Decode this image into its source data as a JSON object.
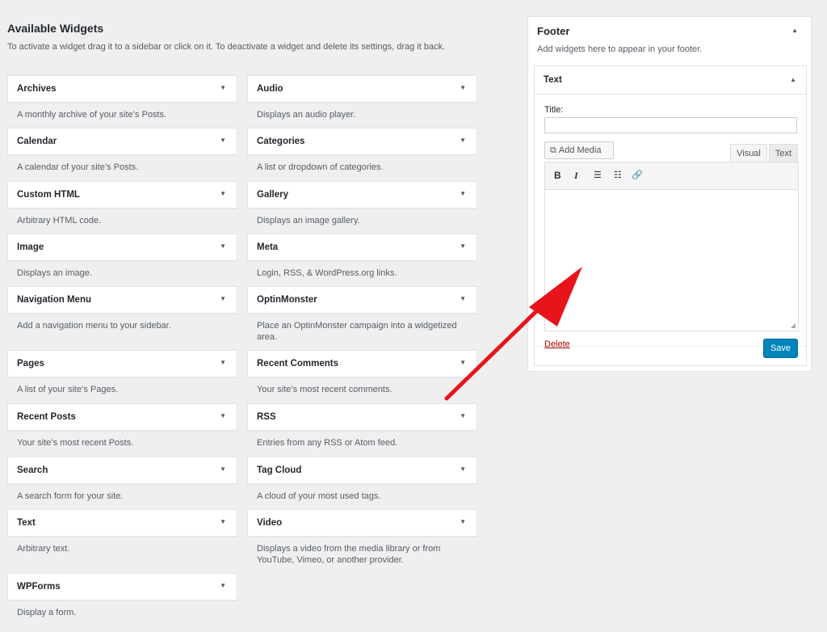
{
  "available": {
    "title": "Available Widgets",
    "intro": "To activate a widget drag it to a sidebar or click on it. To deactivate a widget and delete its settings, drag it back."
  },
  "widgets_left": [
    {
      "title": "Archives",
      "desc": "A monthly archive of your site’s Posts."
    },
    {
      "title": "Calendar",
      "desc": "A calendar of your site’s Posts."
    },
    {
      "title": "Custom HTML",
      "desc": "Arbitrary HTML code."
    },
    {
      "title": "Image",
      "desc": "Displays an image."
    },
    {
      "title": "Navigation Menu",
      "desc": "Add a navigation menu to your sidebar."
    },
    {
      "title": "Pages",
      "desc": "A list of your site’s Pages."
    },
    {
      "title": "Recent Posts",
      "desc": "Your site’s most recent Posts."
    },
    {
      "title": "Search",
      "desc": "A search form for your site."
    },
    {
      "title": "Text",
      "desc": "Arbitrary text."
    },
    {
      "title": "WPForms",
      "desc": "Display a form."
    }
  ],
  "widgets_right": [
    {
      "title": "Audio",
      "desc": "Displays an audio player."
    },
    {
      "title": "Categories",
      "desc": "A list or dropdown of categories."
    },
    {
      "title": "Gallery",
      "desc": "Displays an image gallery."
    },
    {
      "title": "Meta",
      "desc": "Login, RSS, & WordPress.org links."
    },
    {
      "title": "OptinMonster",
      "desc": "Place an OptinMonster campaign into a widgetized area."
    },
    {
      "title": "Recent Comments",
      "desc": "Your site’s most recent comments."
    },
    {
      "title": "RSS",
      "desc": "Entries from any RSS or Atom feed."
    },
    {
      "title": "Tag Cloud",
      "desc": "A cloud of your most used tags."
    },
    {
      "title": "Video",
      "desc": "Displays a video from the media library or from YouTube, Vimeo, or another provider."
    }
  ],
  "icons": {
    "expand": "▼",
    "collapse": "▲",
    "media": "⧉",
    "bold": "B",
    "italic": "I",
    "bullet_list": "☰",
    "numbered_list": "☷",
    "link": "🔗",
    "resize": "◢"
  },
  "footer": {
    "title": "Footer",
    "desc": "Add widgets here to appear in your footer.",
    "text_widget": {
      "title": "Text",
      "title_label": "Title:",
      "title_value": "",
      "add_media": "Add Media",
      "tab_visual": "Visual",
      "tab_text": "Text",
      "delete": "Delete",
      "save": "Save"
    }
  },
  "colors": {
    "save_button": "#0085ba",
    "delete_link": "#a00000",
    "annotation_arrow": "#e8141b"
  }
}
